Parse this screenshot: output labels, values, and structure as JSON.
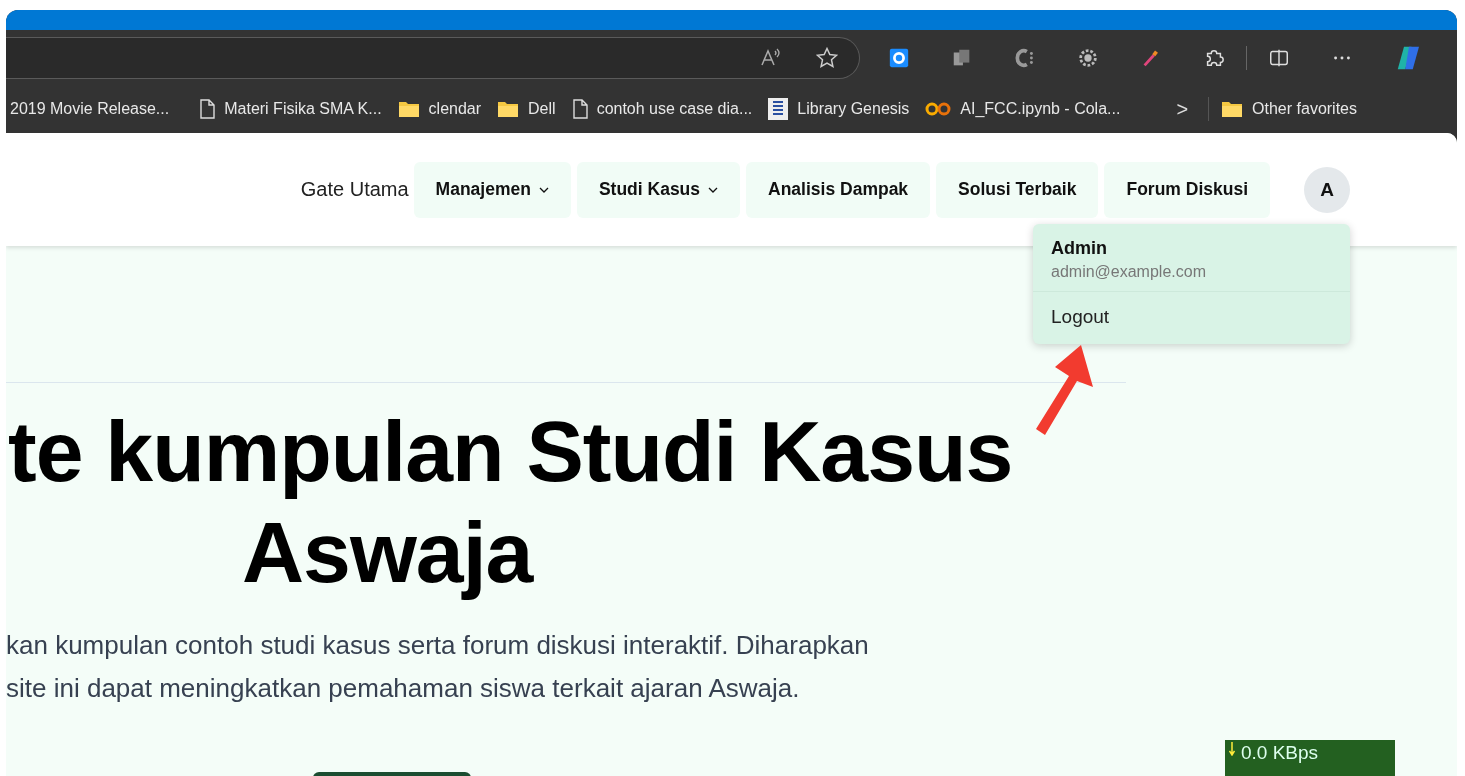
{
  "bookmarks": [
    {
      "label": "2019 Movie Release...",
      "kind": "none"
    },
    {
      "label": "Materi Fisika SMA K...",
      "kind": "page"
    },
    {
      "label": "clendar",
      "kind": "folder"
    },
    {
      "label": "Dell",
      "kind": "folder"
    },
    {
      "label": "contoh use case dia...",
      "kind": "page"
    },
    {
      "label": "Library Genesis",
      "kind": "book"
    },
    {
      "label": "AI_FCC.ipynb - Cola...",
      "kind": "colab"
    }
  ],
  "bookmarks_more": ">",
  "other_favorites": "Other favorites",
  "header": {
    "brand": "Gate Utama",
    "nav": [
      {
        "label": "Manajemen",
        "dropdown": true
      },
      {
        "label": "Studi Kasus",
        "dropdown": true
      },
      {
        "label": "Analisis Dampak",
        "dropdown": false
      },
      {
        "label": "Solusi Terbaik",
        "dropdown": false
      },
      {
        "label": "Forum Diskusi",
        "dropdown": false
      }
    ],
    "avatar": "A"
  },
  "user_menu": {
    "expanded": true,
    "name": "Admin",
    "email": "admin@example.com",
    "items": [
      "Logout"
    ]
  },
  "hero": {
    "title_lines": [
      "te kumpulan Studi Kasus",
      "Aswaja"
    ],
    "text_lines": [
      "kan kumpulan contoh studi kasus serta forum diskusi interaktif. Diharapkan",
      "site ini dapat meningkatkan pemahaman siswa terkait ajaran Aswaja."
    ]
  },
  "net_speed": {
    "download": "0.0 KBps"
  }
}
